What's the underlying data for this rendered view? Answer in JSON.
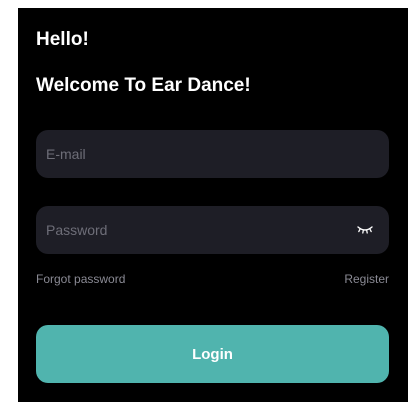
{
  "header": {
    "greeting": "Hello!",
    "welcome": "Welcome To Ear Dance!"
  },
  "form": {
    "email": {
      "value": "",
      "placeholder": "E-mail"
    },
    "password": {
      "value": "",
      "placeholder": "Password",
      "visibility_icon": "eye-closed-icon"
    },
    "forgot_password_label": "Forgot password",
    "register_label": "Register",
    "login_label": "Login"
  },
  "colors": {
    "background": "#000000",
    "field_background": "#1e1e26",
    "accent": "#50b4ae",
    "muted_text": "#8a8a94"
  }
}
